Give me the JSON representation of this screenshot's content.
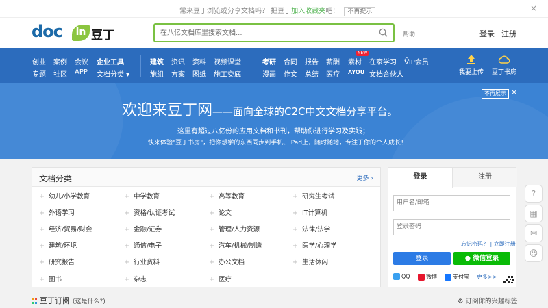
{
  "notice": {
    "text_before": "常来豆丁浏览或分享文档吗？ 把豆丁",
    "link": "加入收藏夹",
    "text_after": "吧！",
    "dismiss": "不再提示",
    "close": "×"
  },
  "header": {
    "logo_text": "doc",
    "logo_leaf": "in",
    "logo_cn": "豆丁",
    "search_placeholder": "在八亿文档库里搜索文档...",
    "help": "帮助",
    "login": "登录",
    "register": "注册"
  },
  "nav": {
    "group1_row1": [
      "创业",
      "案例",
      "会议",
      "企业工具"
    ],
    "group1_row2": [
      "专题",
      "社区",
      "APP",
      "文档分类 ▾"
    ],
    "group2_row1": [
      "建筑",
      "资讯",
      "资料",
      "视频课堂"
    ],
    "group2_row2": [
      "施组",
      "方案",
      "图纸",
      "施工交底"
    ],
    "group3_row1": [
      "考研",
      "合同",
      "报告",
      "薪酬",
      "素材",
      "在家学习",
      "VIP会员"
    ],
    "group3_row2": [
      "漫画",
      "作文",
      "总结",
      "医疗",
      "AYOU",
      "文档合伙人"
    ],
    "new_badge": "NEW",
    "upload": "我要上传",
    "bookroom": "豆丁书房"
  },
  "banner": {
    "title_main": "欢迎来豆丁网",
    "title_dash": "——",
    "title_rest": "面向全球的C2C中文文档分享平台。",
    "line1": "这里有超过八亿份的应用文档和书刊，帮助你进行学习及实践；",
    "line2": "快来体验\"豆丁书房\"，把你想学的东西同步到手机、iPad上，随时随地，专注于你的个人成长！",
    "dismiss": "不再展示",
    "close": "×"
  },
  "categories": {
    "title": "文档分类",
    "more": "更多 ›",
    "items": [
      [
        "幼儿/小学教育",
        "中学教育",
        "高等教育",
        "研究生考试"
      ],
      [
        "外语学习",
        "资格/认证考试",
        "论文",
        "IT计算机"
      ],
      [
        "经济/贸易/财会",
        "金融/证券",
        "管理/人力资源",
        "法律/法学"
      ],
      [
        "建筑/环境",
        "通信/电子",
        "汽车/机械/制造",
        "医学/心理学"
      ],
      [
        "研究报告",
        "行业资料",
        "办公文档",
        "生活休闲"
      ],
      [
        "图书",
        "杂志",
        "医疗",
        ""
      ]
    ]
  },
  "login": {
    "tab_login": "登录",
    "tab_register": "注册",
    "username_placeholder": "用户名/邮箱",
    "password_placeholder": "登录密码",
    "forgot": "忘记密码？",
    "register_now": "立即注册",
    "login_button": "登录",
    "wechat_button": "微信登录",
    "social": [
      "QQ",
      "微博",
      "支付宝",
      "更多>>"
    ]
  },
  "subscribe": {
    "title": "豆丁订阅",
    "note": "(这是什么?)",
    "interest": "订阅你的兴趣标签"
  },
  "colors": {
    "brand_blue": "#2c6cbd",
    "banner_blue": "#3b83d4",
    "accent_green": "#7ac143",
    "wechat_green": "#09bb07"
  }
}
